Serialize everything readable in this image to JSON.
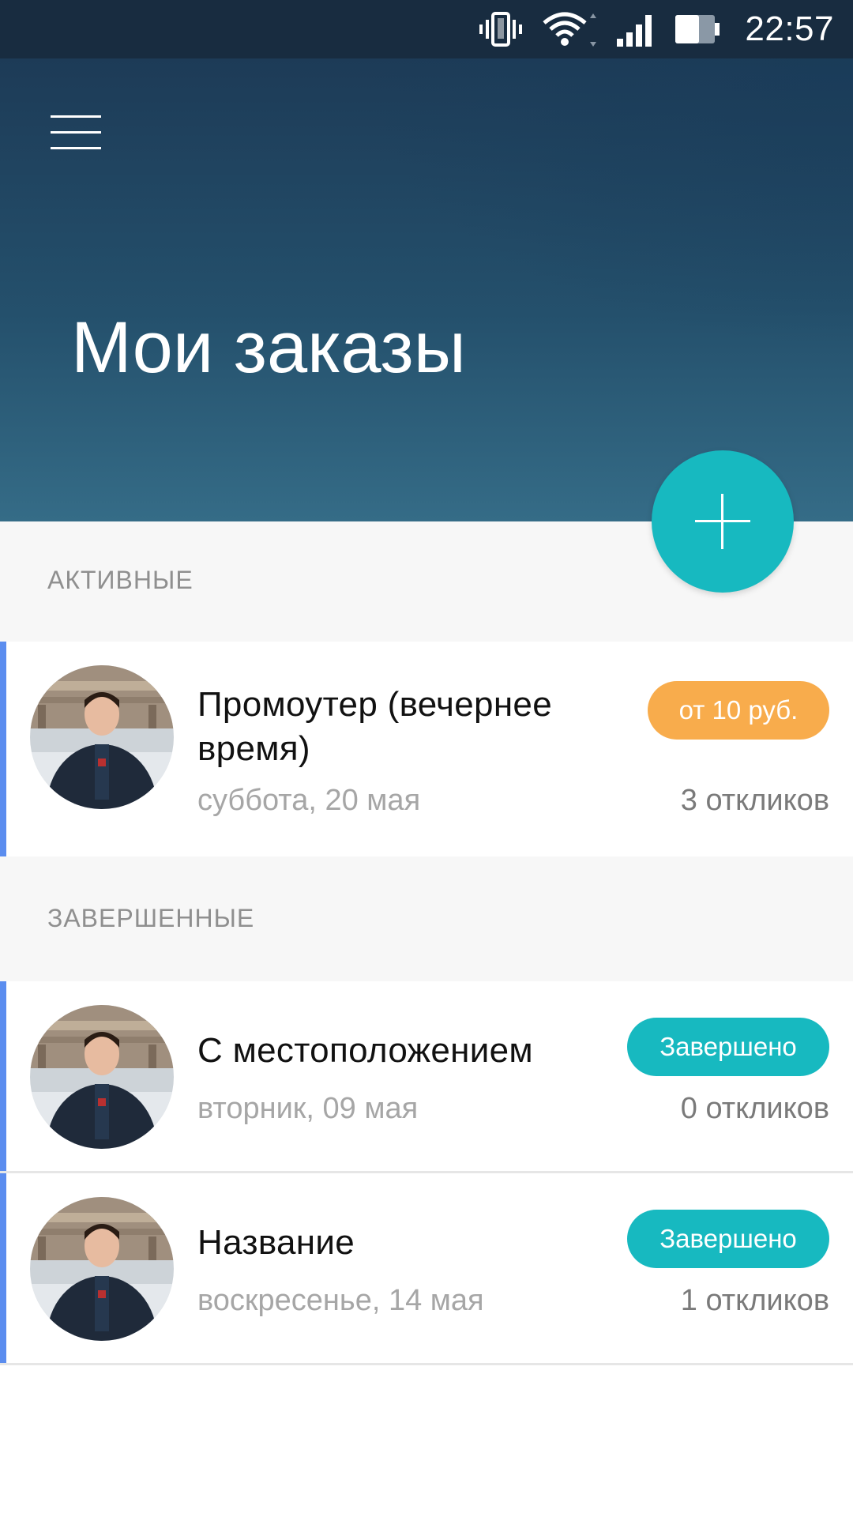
{
  "status_bar": {
    "time": "22:57",
    "icons": [
      "vibrate-icon",
      "wifi-icon",
      "signal-icon",
      "battery-icon"
    ]
  },
  "header": {
    "menu_icon": "hamburger-menu-icon",
    "title": "Мои заказы"
  },
  "fab": {
    "icon": "plus-icon",
    "color": "#17b9c0"
  },
  "sections": {
    "active": {
      "title": "АКТИВНЫЕ",
      "orders": [
        {
          "title": "Промоутер (вечернее время)",
          "date": "суббота, 20 мая",
          "badge": "от 10 руб.",
          "badge_color": "#f8ac4c",
          "responses": "3 откликов"
        }
      ]
    },
    "completed": {
      "title": "ЗАВЕРШЕННЫЕ",
      "orders": [
        {
          "title": "С местоположением",
          "date": "вторник, 09 мая",
          "badge": "Завершено",
          "badge_color": "#17b9c0",
          "responses": "0 откликов"
        },
        {
          "title": "Название",
          "date": "воскресенье, 14 мая",
          "badge": "Завершено",
          "badge_color": "#17b9c0",
          "responses": "1 откликов"
        }
      ]
    }
  },
  "colors": {
    "status_bar": "#182c40",
    "header_top": "#1d3b57",
    "header_bottom": "#356c87",
    "accent_bar": "#5b8def",
    "section_bg": "#f7f7f7"
  }
}
